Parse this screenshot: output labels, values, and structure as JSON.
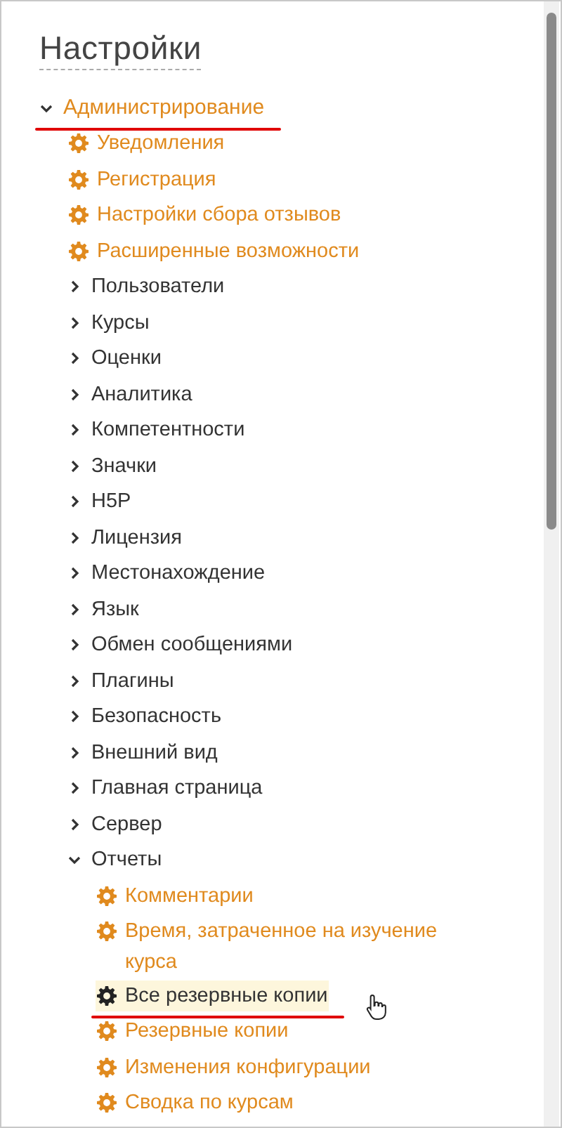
{
  "panel": {
    "title": "Настройки"
  },
  "tree": [
    {
      "label": "Администрирование",
      "kind": "folder",
      "expanded": true,
      "underlined": true,
      "children": [
        {
          "label": "Уведомления",
          "kind": "link",
          "hovered": false,
          "underlined": false
        },
        {
          "label": "Регистрация",
          "kind": "link",
          "hovered": false,
          "underlined": false
        },
        {
          "label": "Настройки сбора отзывов",
          "kind": "link",
          "hovered": false,
          "underlined": false
        },
        {
          "label": "Расширенные возможности",
          "kind": "link",
          "hovered": false,
          "underlined": false
        },
        {
          "label": "Пользователи",
          "kind": "folder",
          "expanded": false,
          "underlined": false
        },
        {
          "label": "Курсы",
          "kind": "folder",
          "expanded": false,
          "underlined": false
        },
        {
          "label": "Оценки",
          "kind": "folder",
          "expanded": false,
          "underlined": false
        },
        {
          "label": "Аналитика",
          "kind": "folder",
          "expanded": false,
          "underlined": false
        },
        {
          "label": "Компетентности",
          "kind": "folder",
          "expanded": false,
          "underlined": false
        },
        {
          "label": "Значки",
          "kind": "folder",
          "expanded": false,
          "underlined": false
        },
        {
          "label": "H5P",
          "kind": "folder",
          "expanded": false,
          "underlined": false
        },
        {
          "label": "Лицензия",
          "kind": "folder",
          "expanded": false,
          "underlined": false
        },
        {
          "label": "Местонахождение",
          "kind": "folder",
          "expanded": false,
          "underlined": false
        },
        {
          "label": "Язык",
          "kind": "folder",
          "expanded": false,
          "underlined": false
        },
        {
          "label": "Обмен сообщениями",
          "kind": "folder",
          "expanded": false,
          "underlined": false
        },
        {
          "label": "Плагины",
          "kind": "folder",
          "expanded": false,
          "underlined": false
        },
        {
          "label": "Безопасность",
          "kind": "folder",
          "expanded": false,
          "underlined": false
        },
        {
          "label": "Внешний вид",
          "kind": "folder",
          "expanded": false,
          "underlined": false
        },
        {
          "label": "Главная страница",
          "kind": "folder",
          "expanded": false,
          "underlined": false
        },
        {
          "label": "Сервер",
          "kind": "folder",
          "expanded": false,
          "underlined": false
        },
        {
          "label": "Отчеты",
          "kind": "folder",
          "expanded": true,
          "underlined": false,
          "children": [
            {
              "label": "Комментарии",
              "kind": "link",
              "hovered": false,
              "underlined": false
            },
            {
              "label": "Время, затраченное на изучение курса",
              "kind": "link",
              "hovered": false,
              "underlined": false
            },
            {
              "label": "Все резервные копии",
              "kind": "link",
              "hovered": true,
              "underlined": true
            },
            {
              "label": "Резервные копии",
              "kind": "link",
              "hovered": false,
              "underlined": false
            },
            {
              "label": "Изменения конфигурации",
              "kind": "link",
              "hovered": false,
              "underlined": false
            },
            {
              "label": "Сводка по курсам",
              "kind": "link",
              "hovered": false,
              "underlined": false
            }
          ]
        }
      ]
    }
  ]
}
